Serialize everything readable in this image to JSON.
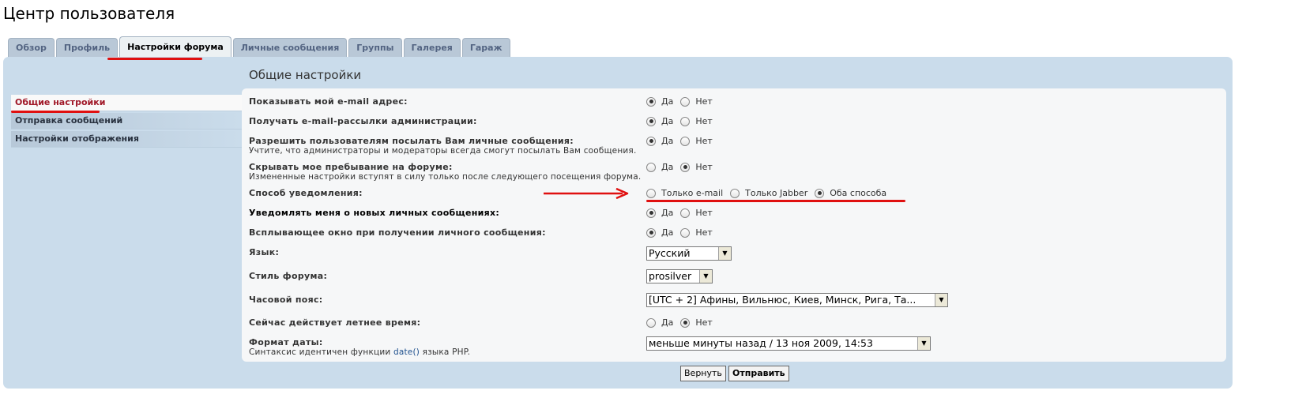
{
  "page": {
    "title": "Центр пользователя"
  },
  "tabs": [
    {
      "label": "Обзор",
      "active": false
    },
    {
      "label": "Профиль",
      "active": false
    },
    {
      "label": "Настройки форума",
      "active": true
    },
    {
      "label": "Личные сообщения",
      "active": false
    },
    {
      "label": "Группы",
      "active": false
    },
    {
      "label": "Галерея",
      "active": false
    },
    {
      "label": "Гараж",
      "active": false
    }
  ],
  "section_title": "Общие настройки",
  "menu": [
    {
      "label": "Общие настройки",
      "active": true
    },
    {
      "label": "Отправка сообщений",
      "active": false
    },
    {
      "label": "Настройки отображения",
      "active": false
    }
  ],
  "settings": {
    "show_email": {
      "label": "Показывать мой e-mail адрес:",
      "yes": "Да",
      "no": "Нет",
      "value": "yes"
    },
    "admin_mail": {
      "label": "Получать e-mail-рассылки администрации:",
      "yes": "Да",
      "no": "Нет",
      "value": "yes"
    },
    "allow_pm": {
      "label": "Разрешить пользователям посылать Вам личные сообщения:",
      "hint": "Учтите, что администраторы и модераторы всегда смогут посылать Вам сообщения.",
      "yes": "Да",
      "no": "Нет",
      "value": "yes"
    },
    "hide_online": {
      "label": "Скрывать мое пребывание на форуме:",
      "hint": "Измененные настройки вступят в силу только после следующего посещения форума.",
      "yes": "Да",
      "no": "Нет",
      "value": "no"
    },
    "notify_method": {
      "label": "Способ уведомления:",
      "options": [
        "Только e-mail",
        "Только Jabber",
        "Оба способа"
      ],
      "value": "Оба способа"
    },
    "notify_pm": {
      "label": "Уведомлять меня о новых личных сообщениях:",
      "yes": "Да",
      "no": "Нет",
      "value": "yes"
    },
    "popup_pm": {
      "label": "Всплывающее окно при получении личного сообщения:",
      "yes": "Да",
      "no": "Нет",
      "value": "yes"
    },
    "language": {
      "label": "Язык:",
      "value": "Русский"
    },
    "style": {
      "label": "Стиль форума:",
      "value": "prosilver"
    },
    "timezone": {
      "label": "Часовой пояс:",
      "value": "[UTC + 2] Афины, Вильнюс, Киев, Минск, Рига, Та..."
    },
    "dst": {
      "label": "Сейчас действует летнее время:",
      "yes": "Да",
      "no": "Нет",
      "value": "no"
    },
    "date_format": {
      "label": "Формат даты:",
      "hint_before": "Синтаксис идентичен функции ",
      "hint_fn": "date()",
      "hint_after": " языка PHP.",
      "value": "меньше минуты назад / 13 ноя 2009, 14:53"
    }
  },
  "buttons": {
    "reset": "Вернуть",
    "submit": "Отправить"
  },
  "colors": {
    "panel": "#cadceb",
    "tab": "#b9c8d7",
    "annotation": "#e01010",
    "active_menu_text": "#a01828"
  },
  "icons": {
    "select_arrow": "▼"
  }
}
